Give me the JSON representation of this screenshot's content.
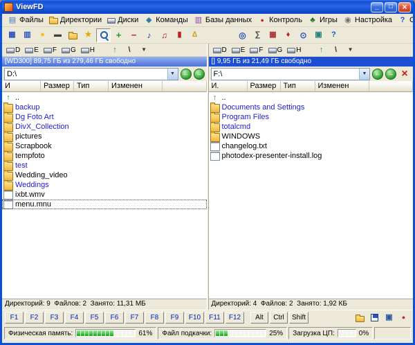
{
  "window": {
    "title": "ViewFD"
  },
  "menu": {
    "items": [
      {
        "id": "files",
        "label": "Файлы",
        "icon": "file-icon"
      },
      {
        "id": "directories",
        "label": "Директории",
        "icon": "folder-icon"
      },
      {
        "id": "disks",
        "label": "Диски",
        "icon": "drive-icon"
      },
      {
        "id": "commands",
        "label": "Команды",
        "icon": "command-icon"
      },
      {
        "id": "databases",
        "label": "Базы данных",
        "icon": "database-icon"
      },
      {
        "id": "control",
        "label": "Контроль",
        "icon": "control-icon"
      },
      {
        "id": "games",
        "label": "Игры",
        "icon": "games-icon"
      },
      {
        "id": "settings",
        "label": "Настройка",
        "icon": "settings-icon"
      },
      {
        "id": "help",
        "label": "Справка",
        "icon": "help-icon"
      }
    ]
  },
  "toolbar": {
    "buttons": [
      {
        "id": "dual-panel",
        "icon": "dual-panel-icon"
      },
      {
        "id": "split-view",
        "icon": "split-horizontal-icon"
      },
      {
        "id": "lamp",
        "icon": "lamp-icon"
      },
      {
        "id": "film",
        "icon": "film-icon"
      },
      {
        "id": "folders",
        "icon": "folders-icon"
      },
      {
        "id": "favorites",
        "icon": "star-icon"
      },
      {
        "id": "search",
        "icon": "search-icon",
        "pressed": true
      },
      {
        "id": "add",
        "icon": "plus-green-icon"
      },
      {
        "id": "remove",
        "icon": "minus-red-icon"
      },
      {
        "id": "music",
        "icon": "note-icon"
      },
      {
        "id": "sound",
        "icon": "sound-icon"
      },
      {
        "id": "marker",
        "icon": "flag-icon"
      },
      {
        "id": "scales",
        "icon": "scales-icon"
      },
      {
        "sep": true
      },
      {
        "id": "globe",
        "icon": "globe-icon"
      },
      {
        "id": "calculator",
        "icon": "calculator-icon"
      },
      {
        "id": "calendar",
        "icon": "calendar-icon"
      },
      {
        "id": "cards",
        "icon": "cards-icon"
      },
      {
        "id": "clock",
        "icon": "clock-icon"
      },
      {
        "id": "monitor",
        "icon": "monitor-icon"
      },
      {
        "id": "help",
        "icon": "question-icon"
      }
    ]
  },
  "panels": {
    "left": {
      "drive_buttons": [
        {
          "label": "D"
        },
        {
          "label": "E"
        },
        {
          "label": "F"
        },
        {
          "label": "G"
        },
        {
          "label": "H"
        }
      ],
      "extra_buttons": [
        {
          "id": "folder-up",
          "icon": "folder-up-icon"
        },
        {
          "id": "root",
          "icon": "root-icon"
        },
        {
          "id": "history",
          "icon": "history-icon"
        }
      ],
      "info": "[WD300] 89,75 ГБ из 279,46 ГБ свободно",
      "path": "D:\\",
      "columns": [
        "И",
        "Размер",
        "Тип",
        "Изменен"
      ],
      "files": [
        {
          "name": "..",
          "kind": "updir",
          "color": "black"
        },
        {
          "name": "backup",
          "kind": "folder",
          "color": "blue"
        },
        {
          "name": "Dg Foto Art",
          "kind": "folder",
          "color": "blue"
        },
        {
          "name": "DivX_Collection",
          "kind": "folder",
          "color": "blue"
        },
        {
          "name": "pictures",
          "kind": "folder",
          "color": "black"
        },
        {
          "name": "Scrapbook",
          "kind": "folder",
          "color": "black"
        },
        {
          "name": "tempfoto",
          "kind": "folder",
          "color": "black"
        },
        {
          "name": "test",
          "kind": "folder",
          "color": "blue"
        },
        {
          "name": "Wedding_video",
          "kind": "folder",
          "color": "black"
        },
        {
          "name": "Weddings",
          "kind": "folder",
          "color": "blue"
        },
        {
          "name": "ixbt.wmv",
          "kind": "file",
          "color": "black"
        },
        {
          "name": "menu.mnu",
          "kind": "file",
          "color": "black",
          "cursor": true
        }
      ],
      "status": "Директорий: 9  Файлов: 2  Занято: 11,31 МБ"
    },
    "right": {
      "drive_buttons": [
        {
          "label": "D"
        },
        {
          "label": "E"
        },
        {
          "label": "F"
        },
        {
          "label": "G"
        },
        {
          "label": "H"
        }
      ],
      "extra_buttons": [
        {
          "id": "folder-up",
          "icon": "folder-up-icon"
        },
        {
          "id": "root",
          "icon": "root-icon"
        },
        {
          "id": "history",
          "icon": "history-icon"
        }
      ],
      "info": "[] 9,95 ГБ из 21,49 ГБ свободно",
      "path": "F:\\",
      "columns": [
        "И.",
        "Размер",
        "Тип",
        "Изменен"
      ],
      "files": [
        {
          "name": "..",
          "kind": "updir",
          "color": "black"
        },
        {
          "name": "Documents and Settings",
          "kind": "folder",
          "color": "blue"
        },
        {
          "name": "Program Files",
          "kind": "folder",
          "color": "blue"
        },
        {
          "name": "totalcmd",
          "kind": "folder",
          "color": "blue"
        },
        {
          "name": "WINDOWS",
          "kind": "folder",
          "color": "black"
        },
        {
          "name": "changelog.txt",
          "kind": "file",
          "color": "black"
        },
        {
          "name": "photodex-presenter-install.log",
          "kind": "file",
          "color": "black"
        }
      ],
      "status": "Директорий: 4  Файлов: 2  Занято: 1,92 КБ"
    }
  },
  "fkeys": {
    "keys": [
      "F1",
      "F2",
      "F3",
      "F4",
      "F5",
      "F6",
      "F7",
      "F8",
      "F9",
      "F10",
      "F11",
      "F12"
    ],
    "modifiers": [
      "Alt",
      "Ctrl",
      "Shift"
    ],
    "tools": [
      {
        "id": "extract",
        "icon": "extract-icon"
      },
      {
        "id": "floppy",
        "icon": "floppy-icon"
      },
      {
        "id": "terminal",
        "icon": "terminal-icon"
      },
      {
        "id": "exit",
        "icon": "exit-icon"
      }
    ]
  },
  "statusbar": {
    "memory": {
      "label": "Физическая память:",
      "percent": 61,
      "value": "61%"
    },
    "pagefile": {
      "label": "Файл подкачки:",
      "percent": 25,
      "value": "25%"
    },
    "cpu": {
      "label": "Загрузка ЦП:",
      "percent": 0,
      "value": "0%"
    }
  },
  "colors": {
    "accent": "#0b50d8",
    "folder": "#efb73a",
    "link": "#2020c8",
    "progress": "#18a818"
  }
}
